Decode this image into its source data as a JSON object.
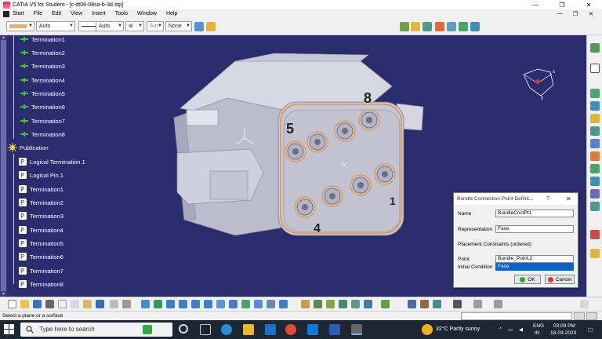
{
  "window": {
    "title": "CATIA V5 for Student - [c-dt06-08sa-b-3d.stp]",
    "minimize": "—",
    "restore": "❐",
    "close": "✕"
  },
  "menu": {
    "items": [
      "Start",
      "File",
      "Edit",
      "View",
      "Insert",
      "Tools",
      "Window",
      "Help"
    ],
    "doc_minimize": "—",
    "doc_restore": "❐",
    "doc_close": "✕"
  },
  "format_bar": {
    "linetype": "Auto",
    "thickness": "Auto",
    "layer_prefix": "Aut",
    "layer": "None"
  },
  "tree": {
    "top_items": [
      "Termination1",
      "Termination2",
      "Termination3",
      "Termination4",
      "Termination5",
      "Termination6",
      "Termination7",
      "Termination8"
    ],
    "publication_label": "Publication",
    "pub_items": [
      "Logical Termination.1",
      "Logical Pin.1",
      "Termination1",
      "Termination2",
      "Termination3",
      "Termination4",
      "Termination5",
      "Termination6",
      "Termination7",
      "Termination8"
    ]
  },
  "model": {
    "label_5": "5",
    "label_8": "8",
    "label_4": "4",
    "label_1": "1"
  },
  "dialog": {
    "title": "Bundle Connection Point Definit...",
    "help": "?",
    "close": "✕",
    "name_label": "Name",
    "name_value": "BundleCnctPt1",
    "representation_label": "Representation",
    "representation_value": "Face",
    "placement_label": "Placement Constraints (ordered)",
    "point_label": "Point",
    "point_value": "Bundle_Point.2",
    "initial_label": "Initial Condition",
    "initial_value": "Face",
    "ok_label": "OK",
    "cancel_label": "Cancel"
  },
  "status": {
    "message": "Select a plane or a surface"
  },
  "taskbar": {
    "search_placeholder": "Type here to search",
    "weather": "32°C  Partly sunny",
    "lang_1": "ENG",
    "lang_2": "IN",
    "time": "03:09 PM",
    "date": "18-03-2023"
  },
  "colors": {
    "viewport_bg": "#2b2c6e",
    "part_body": "#c9c9d6",
    "highlight": "#f08a24",
    "dialog_selection": "#0a64c8"
  }
}
